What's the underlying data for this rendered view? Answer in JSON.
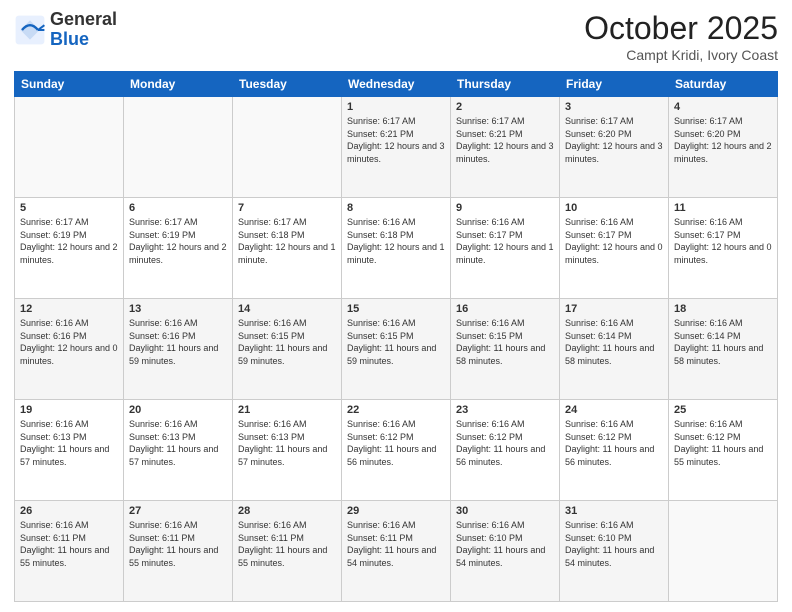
{
  "header": {
    "logo_general": "General",
    "logo_blue": "Blue",
    "month_title": "October 2025",
    "location": "Campt Kridi, Ivory Coast"
  },
  "days_of_week": [
    "Sunday",
    "Monday",
    "Tuesday",
    "Wednesday",
    "Thursday",
    "Friday",
    "Saturday"
  ],
  "weeks": [
    [
      {
        "day": "",
        "info": ""
      },
      {
        "day": "",
        "info": ""
      },
      {
        "day": "",
        "info": ""
      },
      {
        "day": "1",
        "info": "Sunrise: 6:17 AM\nSunset: 6:21 PM\nDaylight: 12 hours and 3 minutes."
      },
      {
        "day": "2",
        "info": "Sunrise: 6:17 AM\nSunset: 6:21 PM\nDaylight: 12 hours and 3 minutes."
      },
      {
        "day": "3",
        "info": "Sunrise: 6:17 AM\nSunset: 6:20 PM\nDaylight: 12 hours and 3 minutes."
      },
      {
        "day": "4",
        "info": "Sunrise: 6:17 AM\nSunset: 6:20 PM\nDaylight: 12 hours and 2 minutes."
      }
    ],
    [
      {
        "day": "5",
        "info": "Sunrise: 6:17 AM\nSunset: 6:19 PM\nDaylight: 12 hours and 2 minutes."
      },
      {
        "day": "6",
        "info": "Sunrise: 6:17 AM\nSunset: 6:19 PM\nDaylight: 12 hours and 2 minutes."
      },
      {
        "day": "7",
        "info": "Sunrise: 6:17 AM\nSunset: 6:18 PM\nDaylight: 12 hours and 1 minute."
      },
      {
        "day": "8",
        "info": "Sunrise: 6:16 AM\nSunset: 6:18 PM\nDaylight: 12 hours and 1 minute."
      },
      {
        "day": "9",
        "info": "Sunrise: 6:16 AM\nSunset: 6:17 PM\nDaylight: 12 hours and 1 minute."
      },
      {
        "day": "10",
        "info": "Sunrise: 6:16 AM\nSunset: 6:17 PM\nDaylight: 12 hours and 0 minutes."
      },
      {
        "day": "11",
        "info": "Sunrise: 6:16 AM\nSunset: 6:17 PM\nDaylight: 12 hours and 0 minutes."
      }
    ],
    [
      {
        "day": "12",
        "info": "Sunrise: 6:16 AM\nSunset: 6:16 PM\nDaylight: 12 hours and 0 minutes."
      },
      {
        "day": "13",
        "info": "Sunrise: 6:16 AM\nSunset: 6:16 PM\nDaylight: 11 hours and 59 minutes."
      },
      {
        "day": "14",
        "info": "Sunrise: 6:16 AM\nSunset: 6:15 PM\nDaylight: 11 hours and 59 minutes."
      },
      {
        "day": "15",
        "info": "Sunrise: 6:16 AM\nSunset: 6:15 PM\nDaylight: 11 hours and 59 minutes."
      },
      {
        "day": "16",
        "info": "Sunrise: 6:16 AM\nSunset: 6:15 PM\nDaylight: 11 hours and 58 minutes."
      },
      {
        "day": "17",
        "info": "Sunrise: 6:16 AM\nSunset: 6:14 PM\nDaylight: 11 hours and 58 minutes."
      },
      {
        "day": "18",
        "info": "Sunrise: 6:16 AM\nSunset: 6:14 PM\nDaylight: 11 hours and 58 minutes."
      }
    ],
    [
      {
        "day": "19",
        "info": "Sunrise: 6:16 AM\nSunset: 6:13 PM\nDaylight: 11 hours and 57 minutes."
      },
      {
        "day": "20",
        "info": "Sunrise: 6:16 AM\nSunset: 6:13 PM\nDaylight: 11 hours and 57 minutes."
      },
      {
        "day": "21",
        "info": "Sunrise: 6:16 AM\nSunset: 6:13 PM\nDaylight: 11 hours and 57 minutes."
      },
      {
        "day": "22",
        "info": "Sunrise: 6:16 AM\nSunset: 6:12 PM\nDaylight: 11 hours and 56 minutes."
      },
      {
        "day": "23",
        "info": "Sunrise: 6:16 AM\nSunset: 6:12 PM\nDaylight: 11 hours and 56 minutes."
      },
      {
        "day": "24",
        "info": "Sunrise: 6:16 AM\nSunset: 6:12 PM\nDaylight: 11 hours and 56 minutes."
      },
      {
        "day": "25",
        "info": "Sunrise: 6:16 AM\nSunset: 6:12 PM\nDaylight: 11 hours and 55 minutes."
      }
    ],
    [
      {
        "day": "26",
        "info": "Sunrise: 6:16 AM\nSunset: 6:11 PM\nDaylight: 11 hours and 55 minutes."
      },
      {
        "day": "27",
        "info": "Sunrise: 6:16 AM\nSunset: 6:11 PM\nDaylight: 11 hours and 55 minutes."
      },
      {
        "day": "28",
        "info": "Sunrise: 6:16 AM\nSunset: 6:11 PM\nDaylight: 11 hours and 55 minutes."
      },
      {
        "day": "29",
        "info": "Sunrise: 6:16 AM\nSunset: 6:11 PM\nDaylight: 11 hours and 54 minutes."
      },
      {
        "day": "30",
        "info": "Sunrise: 6:16 AM\nSunset: 6:10 PM\nDaylight: 11 hours and 54 minutes."
      },
      {
        "day": "31",
        "info": "Sunrise: 6:16 AM\nSunset: 6:10 PM\nDaylight: 11 hours and 54 minutes."
      },
      {
        "day": "",
        "info": ""
      }
    ]
  ]
}
